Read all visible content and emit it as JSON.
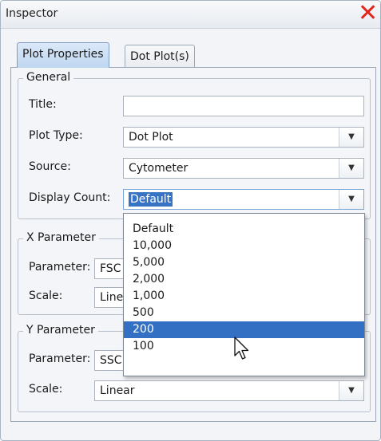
{
  "window": {
    "title": "Inspector",
    "close_glyph": "✕"
  },
  "tabs": [
    {
      "label": "Plot Properties",
      "active": true
    },
    {
      "label": "Dot Plot(s)",
      "active": false
    }
  ],
  "general": {
    "legend": "General",
    "title_label": "Title:",
    "title_value": "",
    "plot_type_label": "Plot Type:",
    "plot_type_value": "Dot Plot",
    "source_label": "Source:",
    "source_value": "Cytometer",
    "display_count_label": "Display Count:",
    "display_count_value": "Default"
  },
  "x_parameter": {
    "legend": "X Parameter",
    "parameter_label": "Parameter:",
    "parameter_value": "FSC",
    "scale_label": "Scale:",
    "scale_value": "Linear"
  },
  "y_parameter": {
    "legend": "Y Parameter",
    "parameter_label": "Parameter:",
    "parameter_value": "SSC",
    "scale_label": "Scale:",
    "scale_value": "Linear"
  },
  "dropdown": {
    "options": [
      "Default",
      "10,000",
      "5,000",
      "2,000",
      "1,000",
      "500",
      "200",
      "100"
    ],
    "highlighted": "200"
  },
  "icons": {
    "close": "close-icon",
    "arrow": "chevron-down-icon",
    "cursor": "mouse-pointer-icon"
  },
  "colors": {
    "close": "#e3241b",
    "selection": "#3370c4",
    "tab_active": "#bfd6f1"
  }
}
